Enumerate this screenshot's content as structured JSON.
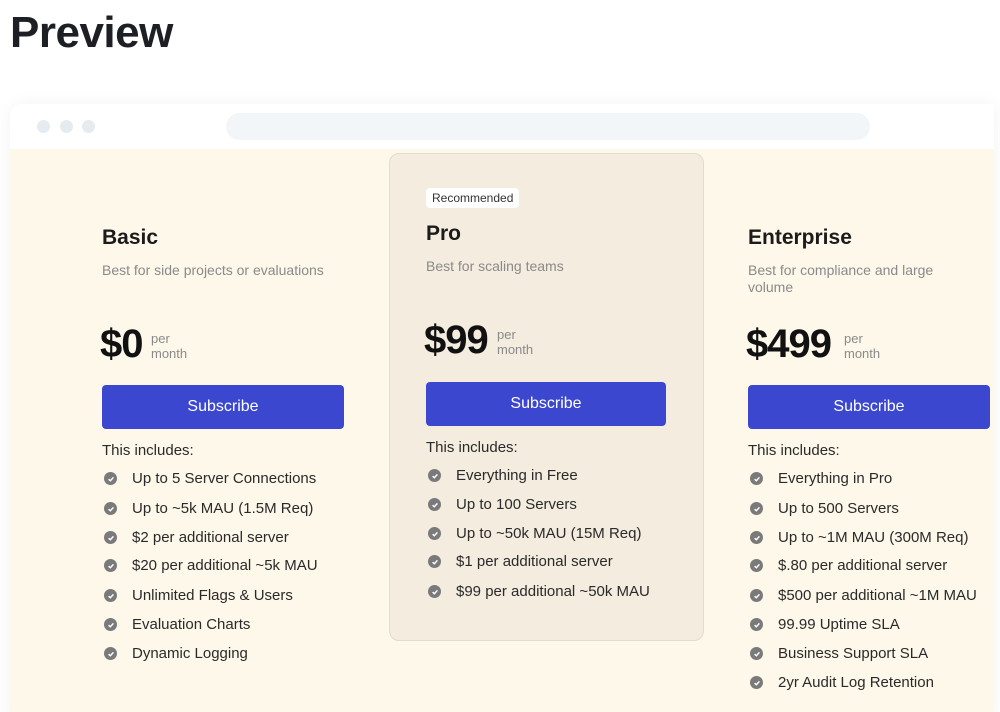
{
  "page": {
    "title": "Preview"
  },
  "colors": {
    "accent": "#3b47cf",
    "background": "#fdf8ea",
    "highlight_card": "#f3ecdf"
  },
  "plans": [
    {
      "name": "Basic",
      "description": "Best for side projects or evaluations",
      "price": "$0",
      "per_line1": "per",
      "per_line2": "month",
      "cta": "Subscribe",
      "includes_label": "This includes:",
      "features": [
        "Up to 5 Server Connections",
        "Up to ~5k MAU (1.5M Req)",
        "$2 per additional server",
        "$20 per additional ~5k MAU",
        "Unlimited Flags & Users",
        "Evaluation Charts",
        "Dynamic Logging"
      ]
    },
    {
      "badge": "Recommended",
      "name": "Pro",
      "description": "Best for scaling teams",
      "price": "$99",
      "per_line1": "per",
      "per_line2": "month",
      "cta": "Subscribe",
      "includes_label": "This includes:",
      "features": [
        "Everything in Free",
        "Up to 100 Servers",
        "Up to ~50k MAU (15M Req)",
        "$1 per additional server",
        "$99 per additional ~50k MAU"
      ]
    },
    {
      "name": "Enterprise",
      "description": "Best for compliance and large volume",
      "price": "$499",
      "per_line1": "per",
      "per_line2": "month",
      "cta": "Subscribe",
      "includes_label": "This includes:",
      "features": [
        "Everything in Pro",
        "Up to 500 Servers",
        "Up to ~1M MAU (300M Req)",
        "$.80 per additional server",
        "$500 per additional ~1M MAU",
        "99.99 Uptime SLA",
        "Business Support SLA",
        "2yr Audit Log Retention"
      ]
    }
  ]
}
